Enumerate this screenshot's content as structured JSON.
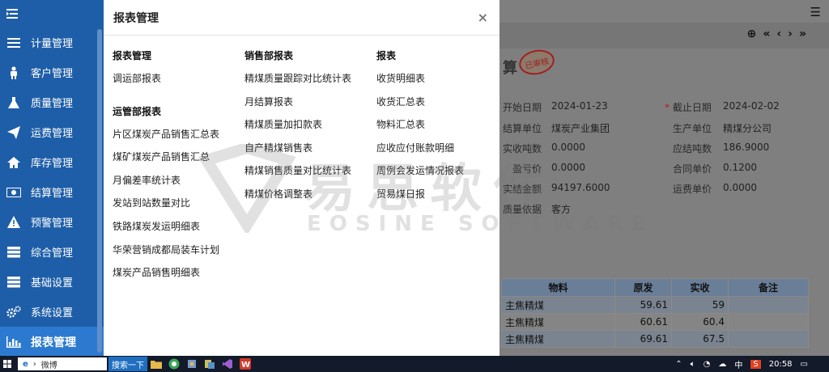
{
  "sidebar": {
    "items": [
      {
        "label": "计量管理",
        "icon": "list-icon"
      },
      {
        "label": "客户管理",
        "icon": "person-icon"
      },
      {
        "label": "质量管理",
        "icon": "flask-icon"
      },
      {
        "label": "运费管理",
        "icon": "paper-plane-icon"
      },
      {
        "label": "库存管理",
        "icon": "home-icon"
      },
      {
        "label": "结算管理",
        "icon": "money-icon"
      },
      {
        "label": "预警管理",
        "icon": "warning-icon"
      },
      {
        "label": "综合管理",
        "icon": "server-icon"
      },
      {
        "label": "基础设置",
        "icon": "server-icon"
      },
      {
        "label": "系统设置",
        "icon": "gears-icon"
      },
      {
        "label": "报表管理",
        "icon": "bar-chart-icon"
      }
    ]
  },
  "modal": {
    "title": "报表管理",
    "close": "×",
    "col1": {
      "heading1": "报表管理",
      "items1": [
        "调运部报表"
      ],
      "heading2": "运管部报表",
      "items2": [
        "片区煤炭产品销售汇总表",
        "煤矿煤炭产品销售汇总",
        "月偏差率统计表",
        "发站到站数量对比",
        "铁路煤炭发运明细表",
        "华荣营销成都局装车计划",
        "煤炭产品销售明细表"
      ]
    },
    "col2": {
      "heading": "销售部报表",
      "items": [
        "精煤质量跟踪对比统计表",
        "月结算报表",
        "精煤质量加扣款表",
        "自产精煤销售表",
        "精煤销售质量对比统计表",
        "精煤价格调整表"
      ]
    },
    "col3": {
      "heading": "报表",
      "items": [
        "收货明细表",
        "收货汇总表",
        "物料汇总表",
        "应收应付账款明细",
        "周例会发运情况报表",
        "贸易煤日报"
      ]
    }
  },
  "background": {
    "title_frag": "算",
    "stamp": "已审核",
    "fields": {
      "start_label": "开始日期",
      "start_value": "2024-01-23",
      "end_label": "截止日期",
      "end_value": "2024-02-02",
      "settle_label": "结算单位",
      "settle_value": "煤炭产业集团",
      "prod_label": "生产单位",
      "prod_value": "精煤分公司",
      "recv_label": "实收吨数",
      "recv_value": "0.0000",
      "due_label": "应结吨数",
      "due_value": "186.9000",
      "loss_label": "盈亏价",
      "loss_value": "0.0000",
      "contract_label": "合同单价",
      "contract_value": "0.1200",
      "amount_label": "实结金额",
      "amount_value": "94197.6000",
      "freight_label": "运费单价",
      "freight_value": "0.0000",
      "quality_label": "质量依据",
      "quality_value": "客方"
    },
    "table": {
      "headers": [
        "物料",
        "原发",
        "实收",
        "备注"
      ],
      "rows": [
        [
          "主焦精煤",
          "59.61",
          "59",
          ""
        ],
        [
          "主焦精煤",
          "60.61",
          "60.4",
          ""
        ],
        [
          "主焦精煤",
          "69.61",
          "67.5",
          ""
        ]
      ]
    }
  },
  "watermark": {
    "text": "易思软件",
    "sub": "EOSINE SOFTWARE"
  },
  "taskbar": {
    "search_text": "微博",
    "search_btn": "搜索一下",
    "time": "20:58",
    "ime": "中"
  }
}
